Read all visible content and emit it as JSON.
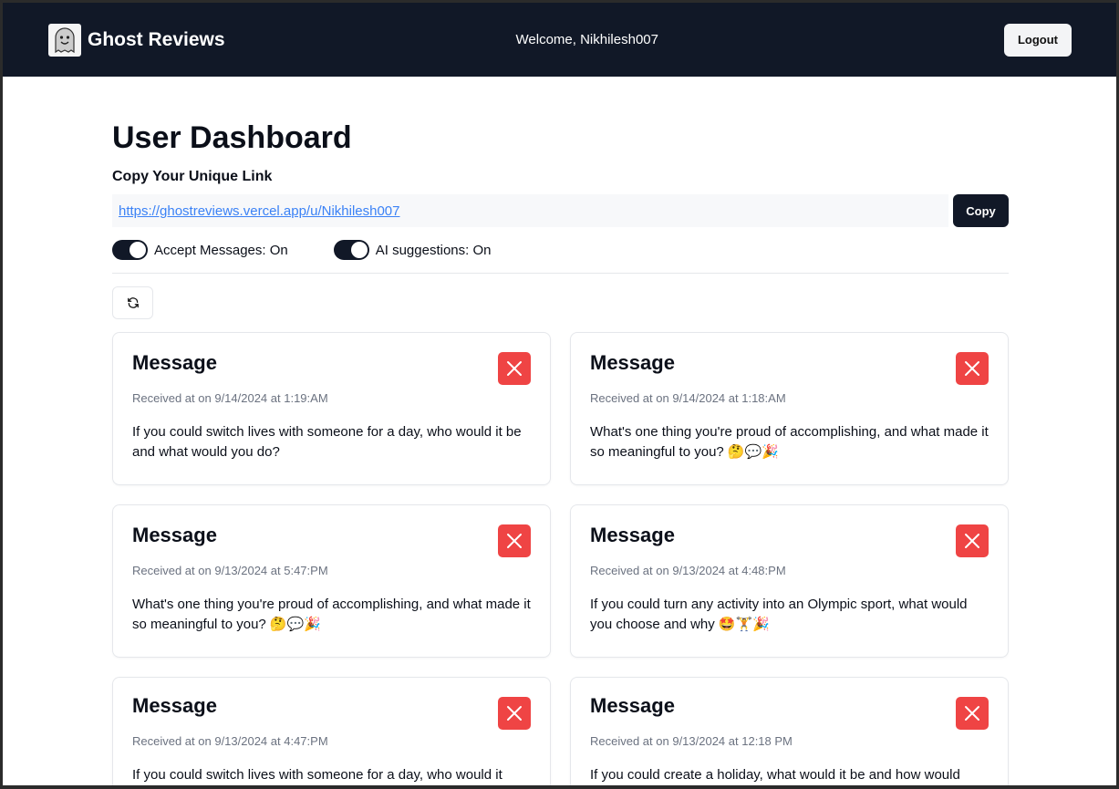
{
  "nav": {
    "brand": "Ghost Reviews",
    "welcome": "Welcome, Nikhilesh007",
    "logout": "Logout"
  },
  "main": {
    "title": "User Dashboard",
    "copy_heading": "Copy Your Unique Link",
    "link": "https://ghostreviews.vercel.app/u/Nikhilesh007",
    "copy_label": "Copy",
    "toggles": [
      {
        "label": "Accept Messages: On",
        "on": true
      },
      {
        "label": "AI suggestions: On",
        "on": true
      }
    ]
  },
  "messages": [
    {
      "title": "Message",
      "time": "Received at on 9/14/2024 at 1:19:AM",
      "text": "If you could switch lives with someone for a day, who would it be and what would you do?"
    },
    {
      "title": "Message",
      "time": "Received at on 9/14/2024 at 1:18:AM",
      "text": "What's one thing you're proud of accomplishing, and what made it so meaningful to you? 🤔💬🎉"
    },
    {
      "title": "Message",
      "time": "Received at on 9/13/2024 at 5:47:PM",
      "text": "What's one thing you're proud of accomplishing, and what made it so meaningful to you? 🤔💬🎉"
    },
    {
      "title": "Message",
      "time": "Received at on 9/13/2024 at 4:48:PM",
      "text": "If you could turn any activity into an Olympic sport, what would you choose and why 🤩🏋️🎉"
    },
    {
      "title": "Message",
      "time": "Received at on 9/13/2024 at 4:47:PM",
      "text": "If you could switch lives with someone for a day, who would it"
    },
    {
      "title": "Message",
      "time": "Received at on 9/13/2024 at 12:18 PM",
      "text": "If you could create a holiday, what would it be and how would"
    }
  ],
  "colors": {
    "nav": "#111827",
    "delete": "#ef4444",
    "link": "#3b82f6"
  }
}
